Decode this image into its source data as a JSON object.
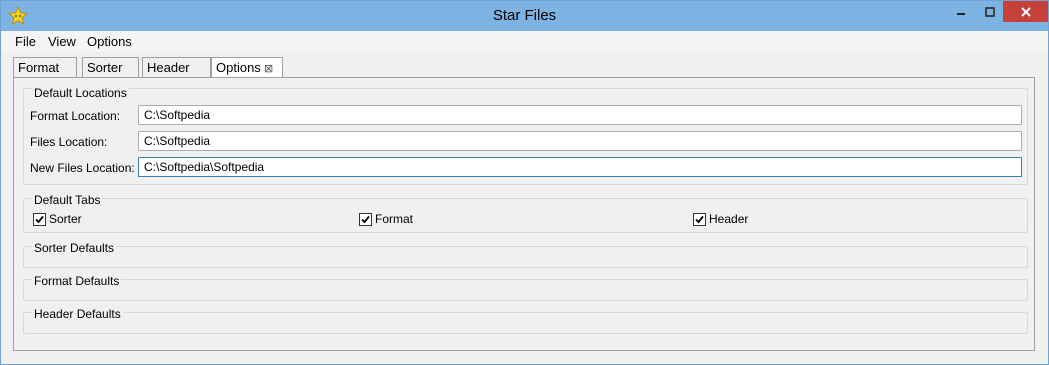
{
  "window": {
    "title": "Star Files"
  },
  "menu": {
    "items": [
      "File",
      "View",
      "Options"
    ]
  },
  "tabs": [
    "Format",
    "Sorter",
    "Header",
    "Options"
  ],
  "active_tab": "Options",
  "default_locations": {
    "title": "Default Locations",
    "format_label": "Format Location:",
    "format_value": "C:\\Softpedia",
    "files_label": "Files Location:",
    "files_value": "C:\\Softpedia",
    "new_files_label": "New Files Location:",
    "new_files_value": "C:\\Softpedia\\Softpedia"
  },
  "default_tabs": {
    "title": "Default Tabs",
    "items": [
      {
        "label": "Sorter",
        "checked": true
      },
      {
        "label": "Format",
        "checked": true
      },
      {
        "label": "Header",
        "checked": true
      }
    ]
  },
  "sorter_defaults": {
    "title": "Sorter Defaults"
  },
  "format_defaults": {
    "title": "Format Defaults"
  },
  "header_defaults": {
    "title": "Header Defaults"
  },
  "icons": {
    "app": "star-icon",
    "close_tab": "close-tab-icon",
    "check": "check-icon"
  },
  "colors": {
    "titlebar": "#7db3e3",
    "close_button": "#c7403a"
  }
}
